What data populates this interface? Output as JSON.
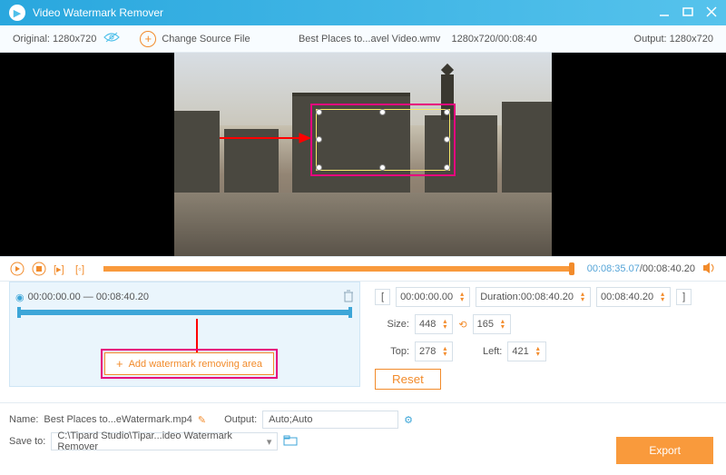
{
  "titlebar": {
    "title": "Video Watermark Remover"
  },
  "infobar": {
    "original": "Original:  1280x720",
    "change_source": "Change Source File",
    "filename": "Best Places to...avel Video.wmv",
    "res_dur": "1280x720/00:08:40",
    "output": "Output:  1280x720"
  },
  "playbar": {
    "current": "00:08:35.07",
    "total": "/00:08:40.20"
  },
  "segment": {
    "range": "00:00:00.00 — 00:08:40.20"
  },
  "controls": {
    "start": "00:00:00.00",
    "dur_label": "Duration:",
    "dur_value": "00:08:40.20",
    "end": "00:08:40.20",
    "size_label": "Size:",
    "width": "448",
    "height": "165",
    "top_label": "Top:",
    "top": "278",
    "left_label": "Left:",
    "left": "421",
    "reset": "Reset"
  },
  "add_area": "Add watermark removing area",
  "footer": {
    "name_label": "Name:",
    "name": "Best Places to...eWatermark.mp4",
    "output_label": "Output:",
    "output_value": "Auto;Auto",
    "save_label": "Save to:",
    "save_path": "C:\\Tipard Studio\\Tipar...ideo Watermark Remover",
    "export": "Export"
  }
}
